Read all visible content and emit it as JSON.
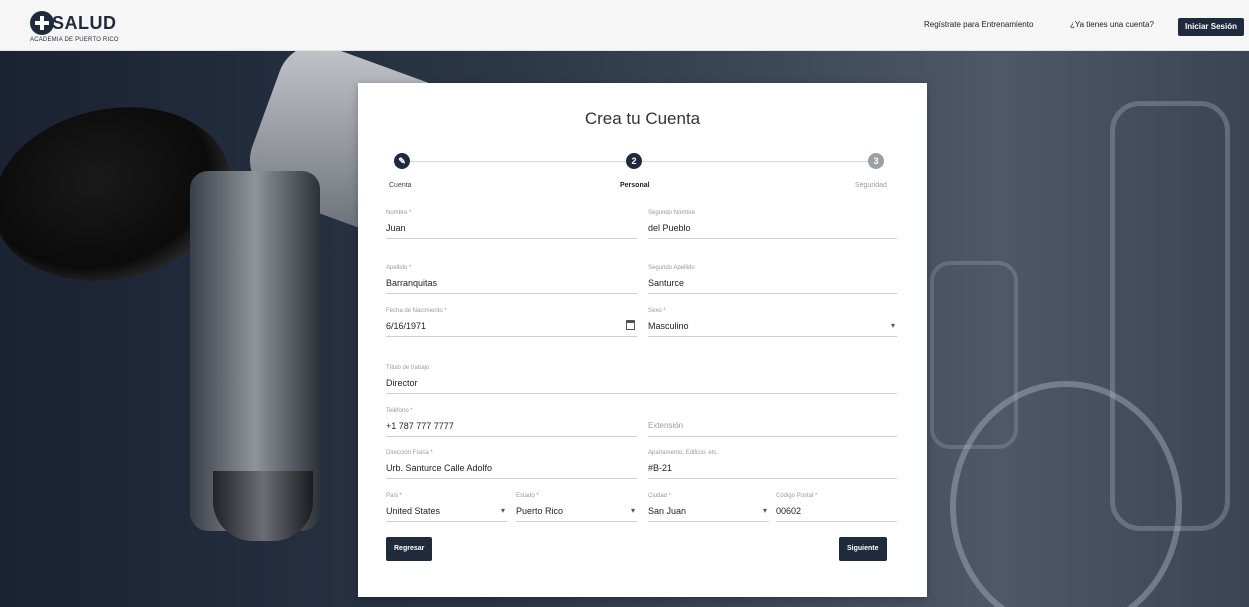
{
  "header": {
    "logo_text": "SALUD",
    "logo_subtext": "ACADEMIA DE PUERTO RICO",
    "register_training_link": "Regístrate para Entrenamiento",
    "have_account_link": "¿Ya tienes una cuenta?",
    "login_button": "Iniciar Sesión"
  },
  "form": {
    "title": "Crea tu Cuenta",
    "steps": [
      {
        "label": "Cuenta",
        "icon": "pencil-check-icon",
        "state": "completed"
      },
      {
        "label": "Personal",
        "icon": "2",
        "state": "active"
      },
      {
        "label": "Seguridad",
        "icon": "3",
        "state": "inactive"
      }
    ],
    "fields": {
      "nombre": {
        "label": "Nombre *",
        "value": "Juan"
      },
      "segundo_nombre": {
        "label": "Segundo Nombre",
        "value": "del Pueblo"
      },
      "apellido": {
        "label": "Apellido *",
        "value": "Barranquitas"
      },
      "segundo_apellido": {
        "label": "Segundo Apellido",
        "value": "Santurce"
      },
      "fecha_nacimiento": {
        "label": "Fecha de Nacimiento *",
        "value": "6/16/1971"
      },
      "sexo": {
        "label": "Sexo *",
        "value": "Masculino"
      },
      "titulo_trabajo": {
        "label": "Título de trabajo",
        "value": "Director"
      },
      "telefono": {
        "label": "Teléfono *",
        "value": "+1 787 777 7777"
      },
      "extension": {
        "placeholder": "Extensión"
      },
      "direccion": {
        "label": "Dirección Física *",
        "value": "Urb. Santurce Calle Adolfo"
      },
      "apartamento": {
        "label": "Apartamento, Edificio, etc.",
        "value": "#B-21"
      },
      "pais": {
        "label": "País *",
        "value": "United States"
      },
      "estado": {
        "label": "Estado *",
        "value": "Puerto Rico"
      },
      "ciudad": {
        "label": "Ciudad *",
        "value": "San Juan"
      },
      "codigo_postal": {
        "label": "Código Postal *",
        "value": "00602"
      }
    },
    "back_button": "Regresar",
    "next_button": "Siguiente"
  },
  "colors": {
    "primary": "#1f2a3d",
    "topbar": "#f6f6f6",
    "card": "#ffffff"
  }
}
